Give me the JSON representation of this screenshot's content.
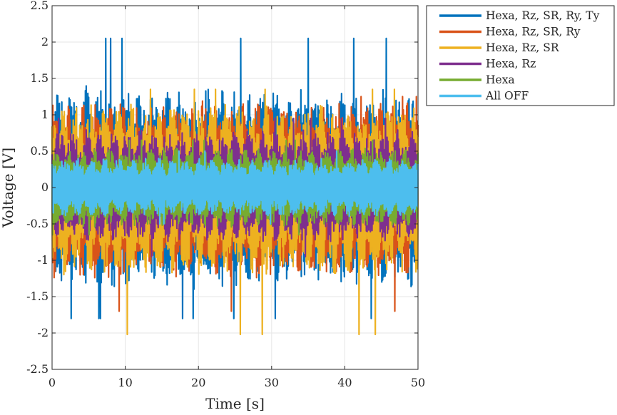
{
  "chart_data": {
    "type": "line",
    "title": "",
    "xlabel": "Time [s]",
    "ylabel": "Voltage [V]",
    "xlim": [
      0,
      50
    ],
    "ylim": [
      -2.5,
      2.5
    ],
    "xticks": [
      "0",
      "10",
      "20",
      "30",
      "40",
      "50"
    ],
    "yticks": [
      "-2.5",
      "-2",
      "-1.5",
      "-1",
      "-0.5",
      "0",
      "0.5",
      "1",
      "1.5",
      "2",
      "2.5"
    ],
    "grid": true,
    "legend_position": "outside-top-right",
    "series": [
      {
        "name": "Hexa, Rz, SR, Ry, Ty",
        "color": "#0072BD",
        "typical_range": [
          -1.4,
          1.4
        ],
        "peak_max": 2.05,
        "peak_min": -1.8
      },
      {
        "name": "Hexa, Rz, SR, Ry",
        "color": "#D95319",
        "typical_range": [
          -1.25,
          1.2
        ],
        "peak_max": 1.25,
        "peak_min": -1.7
      },
      {
        "name": "Hexa, Rz, SR",
        "color": "#EDB120",
        "typical_range": [
          -1.2,
          1.15
        ],
        "peak_max": 1.35,
        "peak_min": -2.02
      },
      {
        "name": "Hexa, Rz",
        "color": "#7E2F8E",
        "typical_range": [
          -0.75,
          0.8
        ],
        "peak_max": 0.95,
        "peak_min": -0.95
      },
      {
        "name": "Hexa",
        "color": "#77AC30",
        "typical_range": [
          -0.55,
          0.55
        ],
        "peak_max": 0.65,
        "peak_min": -0.65
      },
      {
        "name": "All OFF",
        "color": "#4DBEEE",
        "typical_range": [
          -0.4,
          0.4
        ],
        "peak_max": 0.5,
        "peak_min": -0.5
      }
    ]
  }
}
